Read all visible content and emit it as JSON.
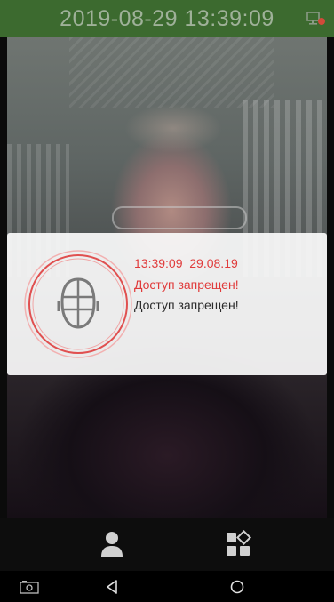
{
  "status_bar": {
    "datetime": "2019-08-29 13:39:09",
    "network_icon": "network-alert-icon"
  },
  "notification": {
    "time": "13:39:09  29.08.19",
    "status": "Доступ запрещен!",
    "message": "Доступ запрещен!",
    "icon": "face-recognition-icon"
  },
  "controls": [
    {
      "icon": "user-icon"
    },
    {
      "icon": "apps-icon"
    }
  ],
  "nav": [
    {
      "icon": "screenshot-icon"
    },
    {
      "icon": "back-icon"
    },
    {
      "icon": "home-icon"
    }
  ],
  "colors": {
    "status_bar_bg": "#3c6a2f",
    "alert_red": "#e03b3b",
    "icon_gray": "#d0d0d0"
  }
}
